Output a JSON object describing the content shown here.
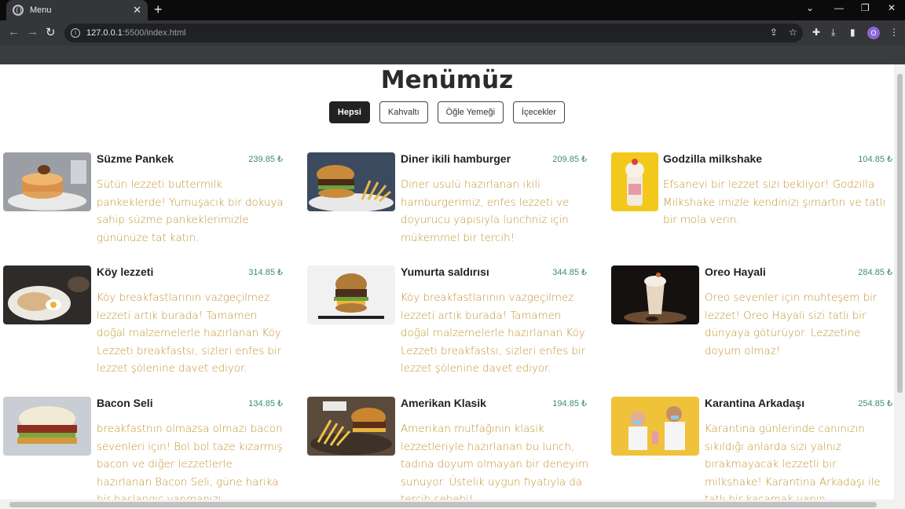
{
  "browser": {
    "tab_title": "Menu",
    "url_host": "127.0.0.1",
    "url_path": ":5500/index.html",
    "profile_initial": "O"
  },
  "page": {
    "title": "Menümüz",
    "filters": [
      "Hepsi",
      "Kahvaltı",
      "Öğle Yemeği",
      "İçecekler"
    ],
    "active_filter": "Hepsi"
  },
  "items": [
    {
      "name": "Süzme Pankek",
      "price": "239.85 ₺",
      "desc": "Sütün lezzeti buttermilk pankeklerde! Yumuşacık bir dokuya sahip süzme pankeklerimizle gününüze tat katın."
    },
    {
      "name": "Diner ikili hamburger",
      "price": "209.85 ₺",
      "desc": "Diner usulü hazırlanan ikili hamburgerimiz, enfes lezzeti ve doyurucu yapısıyla lunchniz için mükemmel bir tercih!"
    },
    {
      "name": "Godzilla milkshake",
      "price": "104.85 ₺",
      "desc": "Efsanevi bir lezzet sizi bekliyor! Godzilla Milkshake imizle kendinizi şımartın ve tatlı bir mola verin."
    },
    {
      "name": "Köy lezzeti",
      "price": "314.85 ₺",
      "desc": "Köy breakfastlarının vazgeçilmez lezzeti artık burada! Tamamen doğal malzemelerle hazırlanan Köy Lezzeti breakfastsı, sizleri enfes bir lezzet şölenine davet ediyor."
    },
    {
      "name": "Yumurta saldırısı",
      "price": "344.85 ₺",
      "desc": "Köy breakfastlarının vazgeçilmez lezzeti artık burada! Tamamen doğal malzemelerle hazırlanan Köy Lezzeti breakfastsı, sizleri enfes bir lezzet şölenine davet ediyor."
    },
    {
      "name": "Oreo Hayali",
      "price": "284.85 ₺",
      "desc": "Oreo sevenler için muhteşem bir lezzet! Oreo Hayali sizi tatlı bir dünyaya götürüyor. Lezzetine doyum olmaz!"
    },
    {
      "name": "Bacon Seli",
      "price": "134.85 ₺",
      "desc": "breakfastnın olmazsa olmazı bacon sevenleri için! Bol bol taze kızarmış bacon ve diğer lezzetlerle hazırlanan Bacon Seli, güne harika bir başlangıç yapmanızı sağlayacak."
    },
    {
      "name": "Amerikan Klasik",
      "price": "194.85 ₺",
      "desc": "Amerikan mutfağının klasik lezzetleriyle hazırlanan bu lunch, tadına doyum olmayan bir deneyim sunuyor. Üstelik uygun fiyatıyla da tercih sebebi!"
    },
    {
      "name": "Karantina Arkadaşı",
      "price": "254.85 ₺",
      "desc": "Karantina günlerinde canınızın sıkıldığı anlarda sizi yalnız bırakmayacak lezzetli bir milkshake! Karantina Arkadaşı ile tatlı bir kaçamak yapın."
    }
  ]
}
